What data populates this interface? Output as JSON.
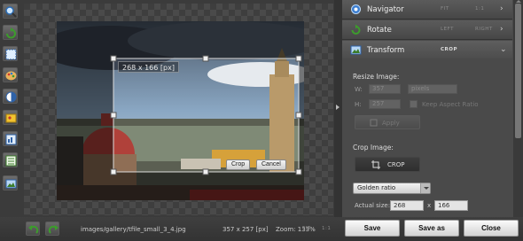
{
  "toolbar": {
    "tools": [
      {
        "icon": "magnifier-icon"
      },
      {
        "icon": "rotate-icon"
      },
      {
        "icon": "crop-selection-icon"
      },
      {
        "icon": "palette-icon"
      },
      {
        "icon": "contrast-icon"
      },
      {
        "icon": "photo-effects-icon"
      },
      {
        "icon": "sharpen-icon"
      },
      {
        "icon": "levels-icon"
      },
      {
        "icon": "resize-image-icon"
      }
    ]
  },
  "canvas": {
    "crop_dimensions": "268 x 166 [px]",
    "crop_button": "Crop",
    "cancel_button": "Cancel"
  },
  "panel": {
    "headers": [
      {
        "icon": "navigator-icon",
        "title": "Navigator",
        "option_a": "FIT",
        "option_b": "1:1"
      },
      {
        "icon": "rotate-icon",
        "title": "Rotate",
        "option_a": "LEFT",
        "option_b": "RIGHT"
      },
      {
        "icon": "transform-icon",
        "title": "Transform",
        "option_a": "CROP",
        "option_b": ""
      }
    ],
    "resize": {
      "title": "Resize Image:",
      "w_label": "W:",
      "h_label": "H:",
      "w_value": "357",
      "h_value": "257",
      "unit": "pixels",
      "keep_aspect": "Keep Aspect Ratio",
      "apply": "Apply"
    },
    "crop": {
      "title": "Crop Image:",
      "button": "CROP",
      "ratio_select": "Golden ratio",
      "actual_size_label": "Actual size:",
      "width": "268",
      "times": "x",
      "height": "166"
    }
  },
  "status": {
    "file_path": "images/gallery/tfile_small_3_4.jpg",
    "image_size": "357 x 257 [px]",
    "zoom": "Zoom: 133%",
    "fit": "FIT",
    "one_to_one": "1:1",
    "save": "Save",
    "save_as": "Save as",
    "close": "Close"
  }
}
